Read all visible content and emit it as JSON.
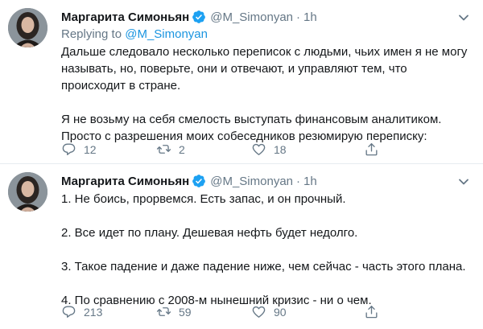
{
  "colors": {
    "link": "#1b95e0",
    "muted": "#657786",
    "text": "#14171a",
    "divider": "#e6ecf0"
  },
  "tweets": [
    {
      "author_name": "Маргарита Симоньян",
      "handle": "@M_Simonyan",
      "separator": "·",
      "time": "1h",
      "replying_prefix": "Replying to",
      "replying_to": "@M_Simonyan",
      "text": "Дальше следовало несколько переписок с людьми, чьих имен я не могу\nназывать, но, поверьте, они и отвечают, и управляют тем, что\nпроисходит в стране.\n\nЯ не возьму на себя смелость выступать финансовым аналитиком.\nПросто с разрешения моих собеседников резюмирую переписку:",
      "reply_count": "12",
      "retweet_count": "2",
      "like_count": "18"
    },
    {
      "author_name": "Маргарита Симоньян",
      "handle": "@M_Simonyan",
      "separator": "·",
      "time": "1h",
      "text": "1. Не боись, прорвемся. Есть запас, и он прочный.\n\n2. Все идет по плану. Дешевая нефть будет недолго.\n\n3. Такое падение и даже падение ниже, чем сейчас - часть этого плана.\n\n4. По сравнению с 2008-м нынешний кризис - ни о чем.",
      "reply_count": "213",
      "retweet_count": "59",
      "like_count": "90"
    }
  ],
  "icons": [
    "reply-icon",
    "retweet-icon",
    "like-icon",
    "share-icon",
    "verified-badge-icon",
    "caret-down-icon"
  ]
}
